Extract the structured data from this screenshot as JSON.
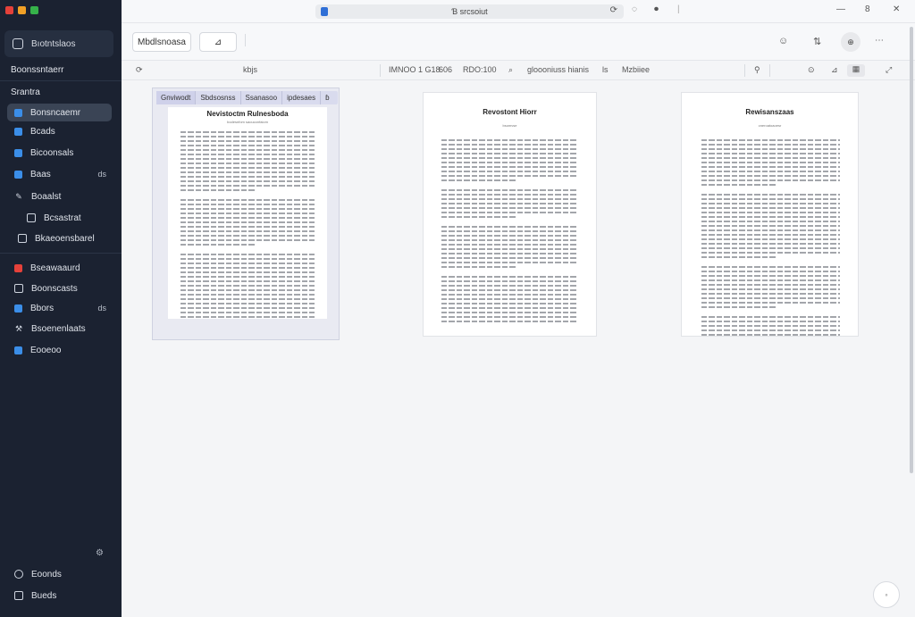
{
  "window": {
    "address_text": "Ɓ srcsoiut"
  },
  "sidebar": {
    "workspace_label": "Bıotntslaos",
    "subtitle": "Boonssntaerr",
    "section_label": "Srantra",
    "items": [
      {
        "label": "Bonsncaemr",
        "color": "#3b8ee8",
        "count": ""
      },
      {
        "label": "Bcads",
        "color": "#3b8ee8",
        "count": ""
      },
      {
        "label": "Bicoonsals",
        "color": "#3b8ee8",
        "count": ""
      },
      {
        "label": "Baas",
        "color": "#3b8ee8",
        "count": "ds"
      },
      {
        "label": "Boaalst",
        "color": "",
        "count": ""
      },
      {
        "label": "Bcsastrat",
        "color": "",
        "count": ""
      },
      {
        "label": "Bkaeoensbarel",
        "color": "",
        "count": ""
      },
      {
        "label": "Bseawaaurd",
        "color": "#e5413a",
        "count": ""
      },
      {
        "label": "Boonscasts",
        "color": "",
        "count": ""
      },
      {
        "label": "Bbors",
        "color": "#3b8ee8",
        "count": "ds"
      },
      {
        "label": "Bsoenenlaats",
        "color": "",
        "count": ""
      },
      {
        "label": "Eooeoo",
        "color": "#3b8ee8",
        "count": ""
      }
    ],
    "bottom_items": [
      {
        "label": "Eoonds"
      },
      {
        "label": "Bueds"
      }
    ]
  },
  "toolbar": {
    "primary_button": "Mbdlsnoasa",
    "secondary_button": "⊿"
  },
  "statusbar": {
    "item1": "kbjs",
    "item2": "IMNOO 1 G18",
    "item3": "606",
    "item4": "RDO:100",
    "item5": "gloooniuss hianis",
    "item6": "ls",
    "item7": "Mzbiiee"
  },
  "pages": [
    {
      "tabs": [
        "Gnviwodt",
        "Sbdsosnss",
        "Ssanasoo",
        "ipdesaes",
        "ɓ"
      ],
      "title": "Nevistoctm Rulnesboda",
      "subtitle": "bodesnfom saouconfaiom"
    },
    {
      "title": "Revostont Hiorr",
      "subtitle": "bsomvse"
    },
    {
      "title": "Rewisanszaas",
      "subtitle": "cneroatoaoesr"
    }
  ]
}
